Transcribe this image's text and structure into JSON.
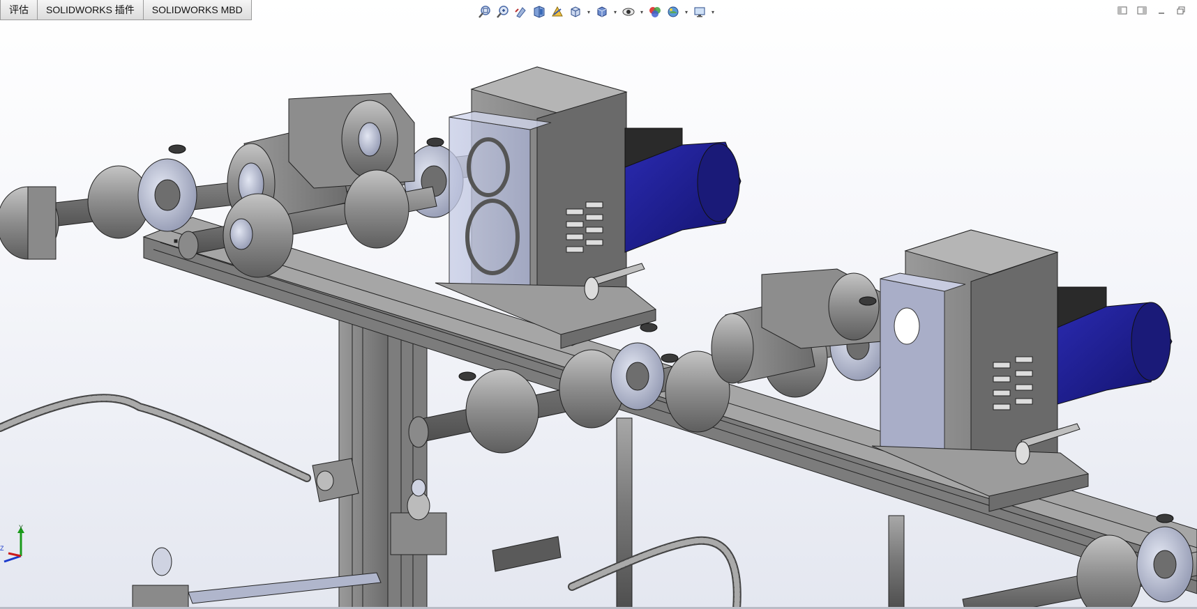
{
  "tabs": [
    {
      "label": "评估"
    },
    {
      "label": "SOLIDWORKS 插件"
    },
    {
      "label": "SOLIDWORKS MBD"
    }
  ],
  "toolbar": [
    {
      "icon": "zoom-to-fit-icon"
    },
    {
      "icon": "zoom-to-area-icon"
    },
    {
      "icon": "previous-view-icon"
    },
    {
      "icon": "section-view-icon"
    },
    {
      "icon": "dynamic-annotation-view-icon"
    },
    {
      "icon": "view-orientation-icon",
      "dropdown": true
    },
    {
      "icon": "display-style-icon",
      "dropdown": true
    },
    {
      "icon": "hide-show-items-icon",
      "dropdown": true
    },
    {
      "icon": "edit-appearance-icon"
    },
    {
      "icon": "apply-scene-icon",
      "dropdown": true
    },
    {
      "icon": "view-settings-icon",
      "dropdown": true
    }
  ],
  "window_controls": [
    {
      "icon": "tile-left-icon"
    },
    {
      "icon": "tile-right-icon"
    },
    {
      "icon": "minimize-icon"
    },
    {
      "icon": "restore-icon"
    }
  ],
  "triad": {
    "y_label": "Y",
    "z_label": "Z"
  },
  "colors": {
    "metal": "#8f8f8f",
    "metal_dark": "#5a5a5a",
    "motor_blue": "#1c1c8f",
    "cover_glass": "#b8bfd8",
    "background_bottom": "#e4e7f0"
  }
}
